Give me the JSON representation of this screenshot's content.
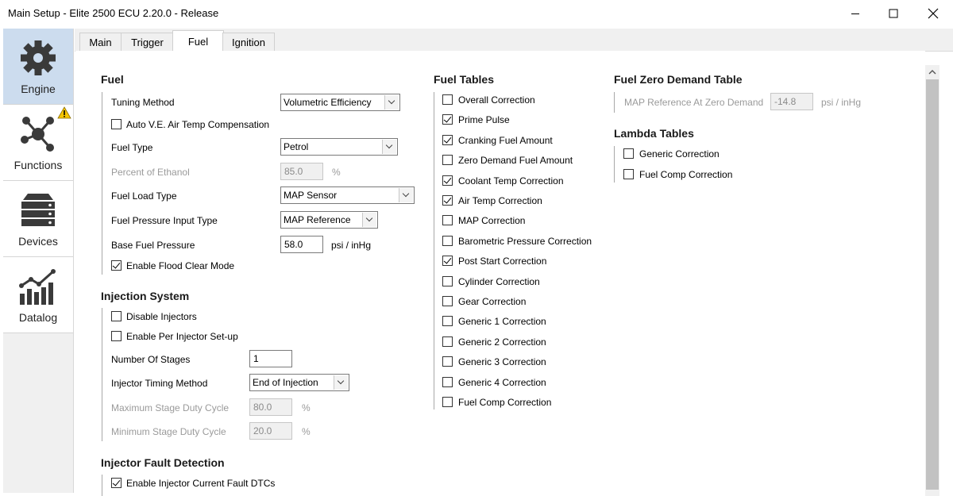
{
  "window": {
    "title": "Main Setup - Elite 2500 ECU 2.20.0 - Release"
  },
  "sidebar": {
    "items": [
      {
        "label": "Engine",
        "icon": "gear-icon"
      },
      {
        "label": "Functions",
        "icon": "network-icon"
      },
      {
        "label": "Devices",
        "icon": "server-stack-icon"
      },
      {
        "label": "Datalog",
        "icon": "bar-chart-icon"
      }
    ]
  },
  "tabs": [
    "Main",
    "Trigger",
    "Fuel",
    "Ignition"
  ],
  "fuel": {
    "header": "Fuel",
    "tuning_method_label": "Tuning Method",
    "tuning_method_value": "Volumetric Efficiency",
    "auto_ve_label": "Auto V.E. Air Temp Compensation",
    "fuel_type_label": "Fuel Type",
    "fuel_type_value": "Petrol",
    "percent_ethanol_label": "Percent of Ethanol",
    "percent_ethanol_value": "85.0",
    "percent_unit": "%",
    "fuel_load_type_label": "Fuel Load Type",
    "fuel_load_type_value": "MAP Sensor",
    "fuel_pressure_input_label": "Fuel Pressure Input Type",
    "fuel_pressure_input_value": "MAP Reference",
    "base_fuel_pressure_label": "Base Fuel Pressure",
    "base_fuel_pressure_value": "58.0",
    "pressure_unit": "psi / inHg",
    "flood_clear_label": "Enable Flood Clear Mode"
  },
  "injection": {
    "header": "Injection System",
    "disable_injectors_label": "Disable Injectors",
    "per_injector_label": "Enable Per Injector Set-up",
    "stages_label": "Number Of Stages",
    "stages_value": "1",
    "timing_method_label": "Injector Timing Method",
    "timing_method_value": "End of Injection",
    "max_duty_label": "Maximum Stage Duty Cycle",
    "max_duty_value": "80.0",
    "min_duty_label": "Minimum Stage Duty Cycle",
    "min_duty_value": "20.0",
    "percent_unit": "%"
  },
  "fault": {
    "header": "Injector Fault Detection",
    "enable_dtc_label": "Enable Injector Current Fault DTCs"
  },
  "fuel_tables": {
    "header": "Fuel Tables",
    "items": [
      {
        "label": "Overall Correction",
        "checked": false
      },
      {
        "label": "Prime Pulse",
        "checked": true
      },
      {
        "label": "Cranking Fuel Amount",
        "checked": true
      },
      {
        "label": "Zero Demand Fuel Amount",
        "checked": false
      },
      {
        "label": "Coolant Temp Correction",
        "checked": true
      },
      {
        "label": "Air Temp Correction",
        "checked": true
      },
      {
        "label": "MAP Correction",
        "checked": false
      },
      {
        "label": "Barometric Pressure Correction",
        "checked": false
      },
      {
        "label": "Post Start Correction",
        "checked": true
      },
      {
        "label": "Cylinder Correction",
        "checked": false
      },
      {
        "label": "Gear Correction",
        "checked": false
      },
      {
        "label": "Generic 1 Correction",
        "checked": false
      },
      {
        "label": "Generic 2 Correction",
        "checked": false
      },
      {
        "label": "Generic 3 Correction",
        "checked": false
      },
      {
        "label": "Generic 4 Correction",
        "checked": false
      },
      {
        "label": "Fuel Comp Correction",
        "checked": false
      }
    ]
  },
  "zero_demand": {
    "header": "Fuel Zero Demand Table",
    "map_ref_label": "MAP Reference At Zero Demand",
    "map_ref_value": "-14.8",
    "unit": "psi / inHg"
  },
  "lambda_tables": {
    "header": "Lambda Tables",
    "items": [
      {
        "label": "Generic Correction",
        "checked": false
      },
      {
        "label": "Fuel Comp Correction",
        "checked": false
      }
    ]
  },
  "colors": {
    "active_sidebar": "#ccdcee",
    "warning": "#f5c400"
  }
}
